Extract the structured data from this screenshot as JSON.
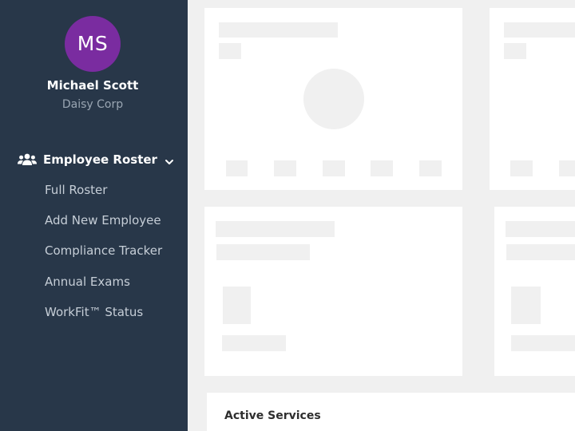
{
  "user": {
    "initials": "MS",
    "name": "Michael Scott",
    "company": "Daisy Corp",
    "avatar_color": "#7a2ca0"
  },
  "sidebar": {
    "background": "#283749",
    "group": {
      "icon": "users-icon",
      "label": "Employee Roster",
      "expanded": true
    },
    "items": [
      {
        "label": "Full Roster"
      },
      {
        "label": "Add New Employee"
      },
      {
        "label": "Compliance Tracker"
      },
      {
        "label": "Annual Exams"
      },
      {
        "label": "WorkFit™ Status"
      }
    ]
  },
  "main": {
    "services_section": {
      "title": "Active Services"
    }
  }
}
